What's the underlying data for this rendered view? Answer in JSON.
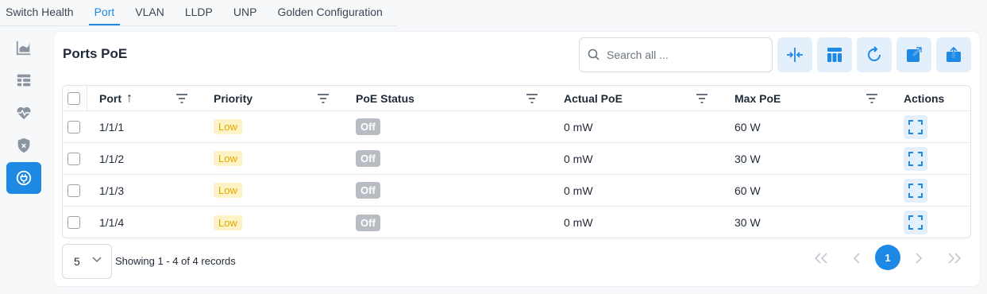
{
  "tabs": [
    {
      "label": "Switch Health"
    },
    {
      "label": "Port",
      "active": true
    },
    {
      "label": "VLAN"
    },
    {
      "label": "LLDP"
    },
    {
      "label": "UNP"
    },
    {
      "label": "Golden Configuration"
    }
  ],
  "rail": [
    {
      "icon": "area-chart-icon"
    },
    {
      "icon": "table-layout-icon"
    },
    {
      "icon": "heart-pulse-icon"
    },
    {
      "icon": "shield-x-icon"
    },
    {
      "icon": "poe-plug-icon",
      "active": true
    }
  ],
  "card": {
    "title": "Ports PoE",
    "search_placeholder": "Search all ..."
  },
  "toolbar": [
    "compress-columns-icon",
    "columns-icon",
    "refresh-icon",
    "export-icon",
    "upload-icon"
  ],
  "table": {
    "columns": [
      "Port",
      "Priority",
      "PoE Status",
      "Actual PoE",
      "Max PoE",
      "Actions"
    ],
    "sort_indicator": "↑",
    "rows": [
      {
        "port": "1/1/1",
        "priority": "Low",
        "status": "Off",
        "actual": "0 mW",
        "max": "60 W"
      },
      {
        "port": "1/1/2",
        "priority": "Low",
        "status": "Off",
        "actual": "0 mW",
        "max": "30 W"
      },
      {
        "port": "1/1/3",
        "priority": "Low",
        "status": "Off",
        "actual": "0 mW",
        "max": "60 W"
      },
      {
        "port": "1/1/4",
        "priority": "Low",
        "status": "Off",
        "actual": "0 mW",
        "max": "30 W"
      }
    ]
  },
  "footer": {
    "page_size": "5",
    "records_text": "Showing 1 - 4 of 4 records",
    "current_page": "1"
  },
  "colors": {
    "accent": "#1e88e5",
    "accent_light": "#e3f0fc",
    "low_badge": "#fef3c7",
    "off_badge": "#b8bdc4"
  }
}
